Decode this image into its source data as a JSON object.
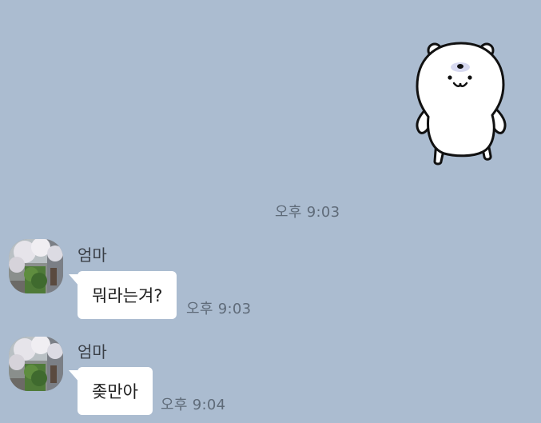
{
  "chat": {
    "background_color": "#abbcd0",
    "sent_sticker": {
      "icon": "white-bear-sticker",
      "time": "오후 9:03"
    },
    "messages": [
      {
        "sender": "엄마",
        "avatar_icon": "cherry-blossom-photo",
        "text": "뭐라는겨?",
        "time": "오후 9:03"
      },
      {
        "sender": "엄마",
        "avatar_icon": "cherry-blossom-photo",
        "text": "좆만아",
        "time": "오후 9:04"
      }
    ]
  }
}
